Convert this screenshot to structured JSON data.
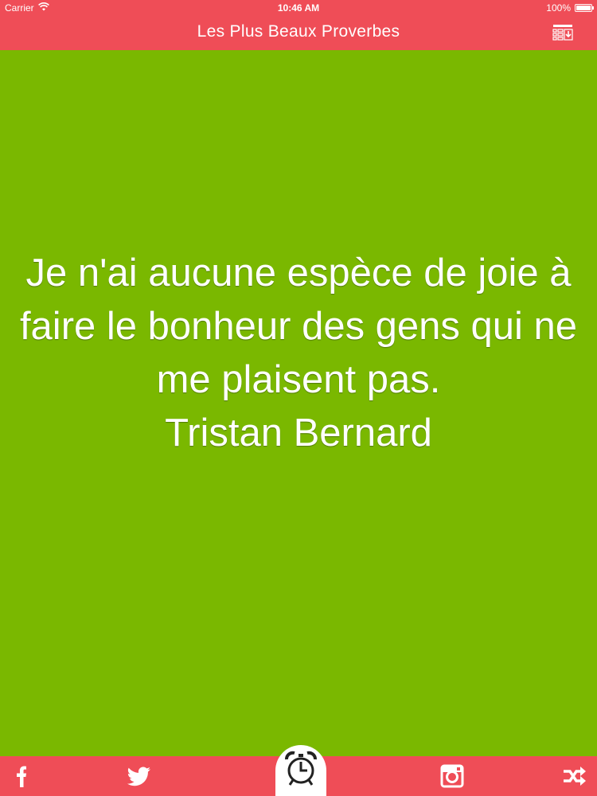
{
  "status_bar": {
    "carrier": "Carrier",
    "time": "10:46 AM",
    "battery": "100%",
    "battery_level": 1.0
  },
  "nav_bar": {
    "title": "Les Plus Beaux Proverbes",
    "action_icon": "list-download-icon"
  },
  "quote": {
    "text": "Je n'ai aucune espèce de joie à faire le bonheur des gens qui ne me plaisent pas.",
    "author": "Tristan Bernard"
  },
  "tab_bar": {
    "items": [
      {
        "icon": "facebook-icon"
      },
      {
        "icon": "twitter-icon"
      },
      {
        "icon": "alarm-clock-icon"
      },
      {
        "icon": "instagram-icon"
      },
      {
        "icon": "shuffle-icon"
      }
    ]
  },
  "colors": {
    "accent": "#ef4d57",
    "background": "#7ab800",
    "text": "#ffffff"
  }
}
